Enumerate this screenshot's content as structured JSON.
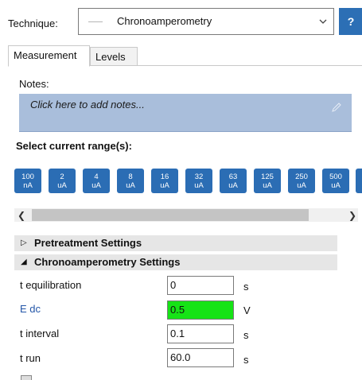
{
  "technique": {
    "label": "Technique:",
    "value": "Chronoamperometry",
    "help": "?"
  },
  "tabs": [
    {
      "label": "Measurement",
      "active": true
    },
    {
      "label": "Levels",
      "active": false
    }
  ],
  "notes": {
    "label": "Notes:",
    "placeholder": "Click here to add notes..."
  },
  "current_range": {
    "label": "Select current range(s):",
    "buttons": [
      {
        "top": "100",
        "bottom": "nA"
      },
      {
        "top": "2",
        "bottom": "uA"
      },
      {
        "top": "4",
        "bottom": "uA"
      },
      {
        "top": "8",
        "bottom": "uA"
      },
      {
        "top": "16",
        "bottom": "uA"
      },
      {
        "top": "32",
        "bottom": "uA"
      },
      {
        "top": "63",
        "bottom": "uA"
      },
      {
        "top": "125",
        "bottom": "uA"
      },
      {
        "top": "250",
        "bottom": "uA"
      },
      {
        "top": "500",
        "bottom": "uA"
      }
    ]
  },
  "sections": {
    "pretreatment": "Pretreatment Settings",
    "chrono": "Chronoamperometry Settings"
  },
  "params": [
    {
      "label": "t equilibration",
      "value": "0",
      "unit": "s"
    },
    {
      "label": "E dc",
      "value": "0.5",
      "unit": "V"
    },
    {
      "label": "t interval",
      "value": "0.1",
      "unit": "s"
    },
    {
      "label": "t run",
      "value": "60.0",
      "unit": "s"
    }
  ],
  "colors": {
    "accent": "#2b6db4",
    "notes_bg": "#a9bedb",
    "active_input": "#16e316",
    "link_label": "#2356a8"
  }
}
